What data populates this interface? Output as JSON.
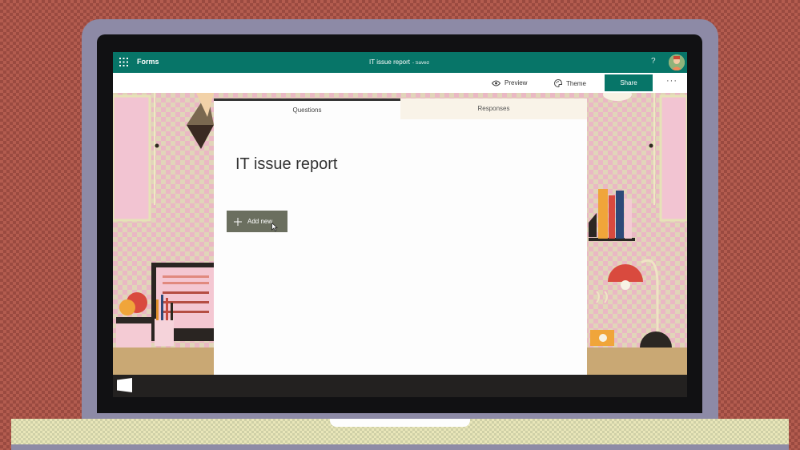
{
  "appbar": {
    "app_name": "Forms",
    "doc_title": "IT issue report",
    "doc_status": "- Saved",
    "help": "?"
  },
  "cmdbar": {
    "preview_label": "Preview",
    "theme_label": "Theme",
    "share_label": "Share",
    "more": "···"
  },
  "tabs": {
    "questions": "Questions",
    "responses": "Responses"
  },
  "form": {
    "title": "IT issue report",
    "add_new_label": "Add new"
  },
  "colors": {
    "brand": "#077568",
    "add_button": "#6b6f5f",
    "backdrop": "#b35c4f"
  }
}
